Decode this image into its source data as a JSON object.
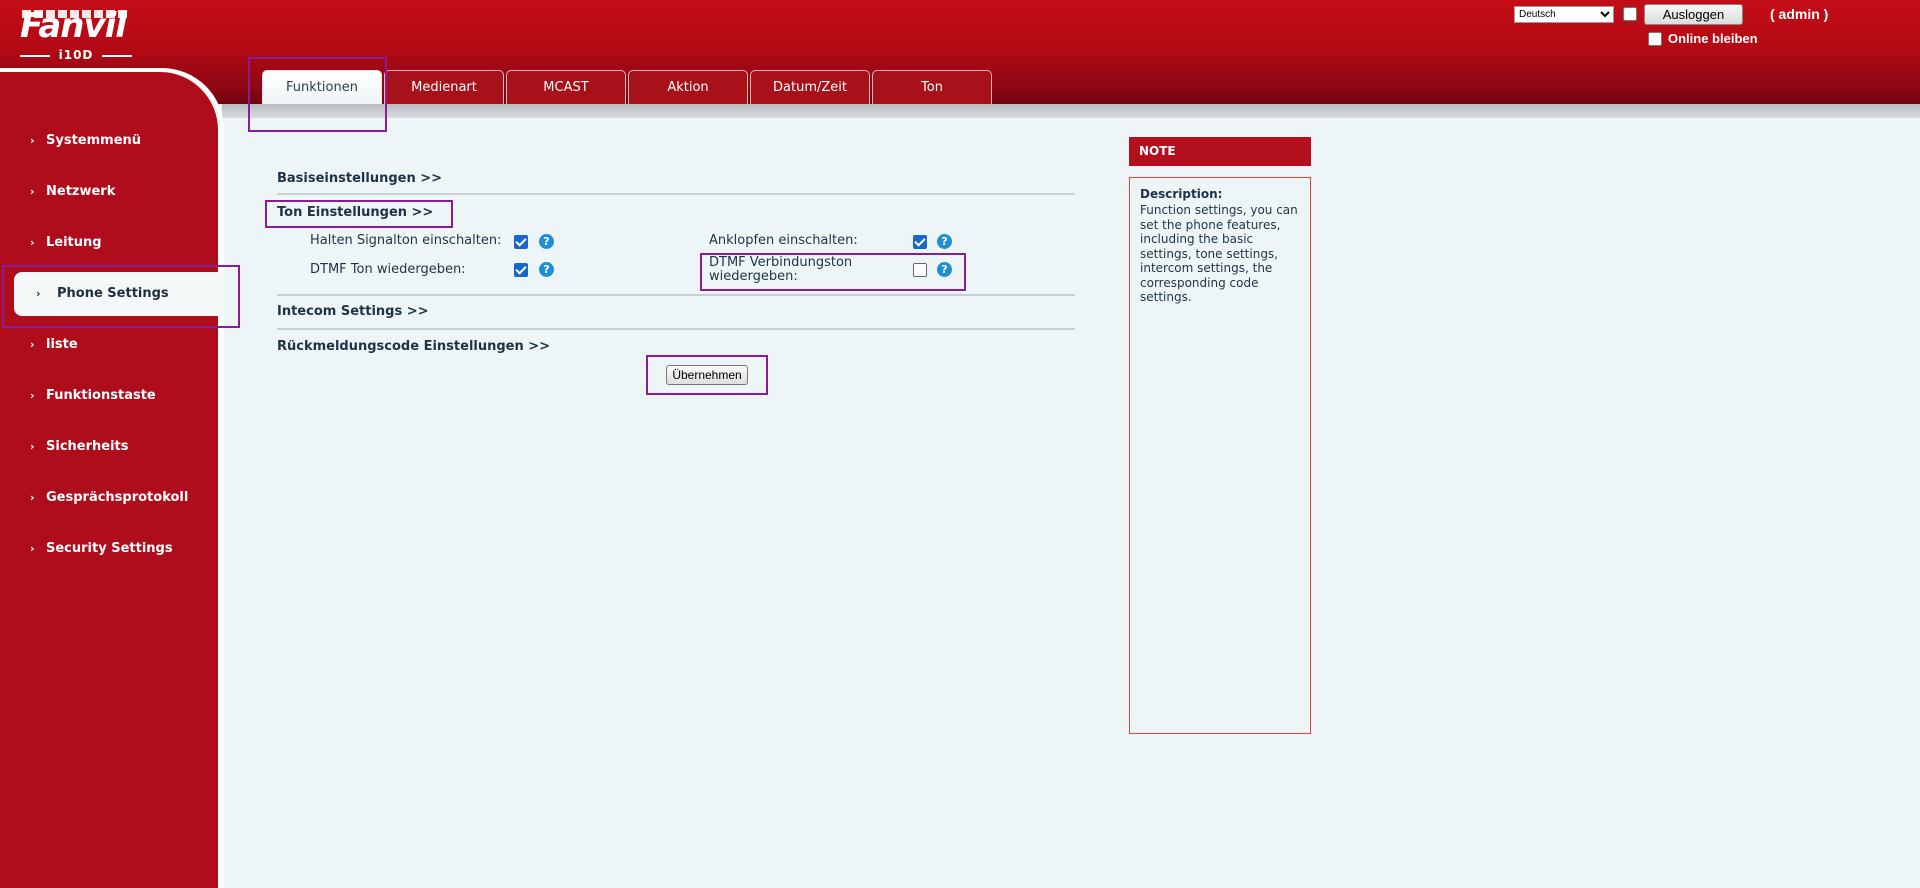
{
  "header": {
    "logo_text": "Fanvil",
    "model": "i10D",
    "language_selected": "Deutsch",
    "logout_label": "Ausloggen",
    "admin_label": "( admin )",
    "stay_online_label": "Online bleiben",
    "stay_online_checked": false
  },
  "tabs": [
    {
      "label": "Funktionen",
      "active": true
    },
    {
      "label": "Medienart",
      "active": false
    },
    {
      "label": "MCAST",
      "active": false
    },
    {
      "label": "Aktion",
      "active": false
    },
    {
      "label": "Datum/Zeit",
      "active": false
    },
    {
      "label": "Ton",
      "active": false
    }
  ],
  "sidebar": {
    "items": [
      {
        "label": "Systemmenü",
        "active": false
      },
      {
        "label": "Netzwerk",
        "active": false
      },
      {
        "label": "Leitung",
        "active": false
      },
      {
        "label": "Phone Settings",
        "active": true
      },
      {
        "label": "liste",
        "active": false
      },
      {
        "label": "Funktionstaste",
        "active": false
      },
      {
        "label": "Sicherheits",
        "active": false
      },
      {
        "label": "Gesprächsprotokoll",
        "active": false
      },
      {
        "label": "Security Settings",
        "active": false
      }
    ]
  },
  "main": {
    "sections": [
      {
        "title": "Basiseinstellungen >>"
      },
      {
        "title": "Ton Einstellungen >>"
      },
      {
        "title": "Intecom Settings >>"
      },
      {
        "title": "Rückmeldungscode Einstellungen >>"
      }
    ],
    "tone_fields": [
      {
        "label": "Halten Signalton einschalten:",
        "checked": true
      },
      {
        "label": "Anklopfen einschalten:",
        "checked": true
      },
      {
        "label": "DTMF Ton wiedergeben:",
        "checked": true
      },
      {
        "label": "DTMF Verbindungston wiedergeben:",
        "checked": false
      }
    ],
    "apply_label": "Übernehmen"
  },
  "note": {
    "header": "NOTE",
    "title": "Description:",
    "text": "Function settings, you can set the phone features, including the basic settings, tone settings, intercom settings, the corresponding code settings."
  },
  "colors": {
    "brand_red": "#b00d1c",
    "checkbox_blue": "#1669c8",
    "help_blue": "#1f8fd6",
    "highlight_purple": "#8a1c9a"
  }
}
